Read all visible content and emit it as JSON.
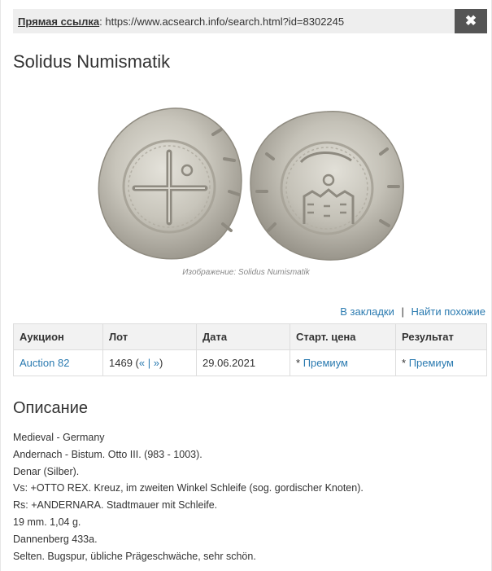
{
  "link_bar": {
    "label": "Прямая ссылка",
    "url": "https://www.acsearch.info/search.html?id=8302245",
    "close_glyph": "✖"
  },
  "auctioneer": "Solidus Numismatik",
  "image_caption": "Изображение: Solidus Numismatik",
  "actions": {
    "bookmark": "В закладки",
    "separator": "|",
    "similar": "Найти похожие"
  },
  "table": {
    "headers": [
      "Аукцион",
      "Лот",
      "Дата",
      "Старт. цена",
      "Результат"
    ],
    "row": {
      "auction": "Auction 82",
      "lot": "1469",
      "lot_prev": "«",
      "lot_sep": "|",
      "lot_next": "»",
      "date": "29.06.2021",
      "start_prefix": "*",
      "start_value": "Премиум",
      "result_prefix": "*",
      "result_value": "Премиум"
    }
  },
  "description": {
    "title": "Описание",
    "lines": [
      "Medieval - Germany",
      "Andernach - Bistum. Otto III. (983 - 1003).",
      "Denar (Silber).",
      "Vs: +OTTO REX. Kreuz, im zweiten Winkel Schleife (sog. gordischer Knoten).",
      "Rs: +ANDERNARA. Stadtmauer mit Schleife.",
      "19 mm. 1,04 g.",
      "Dannenberg 433a.",
      "Selten. Bugspur, übliche Prägeschwäche, sehr schön."
    ]
  },
  "colors": {
    "link": "#2a7ab0",
    "close_bg": "#555555",
    "bar_bg": "#eeeeee",
    "coin_silver": "#c9c6bc"
  }
}
